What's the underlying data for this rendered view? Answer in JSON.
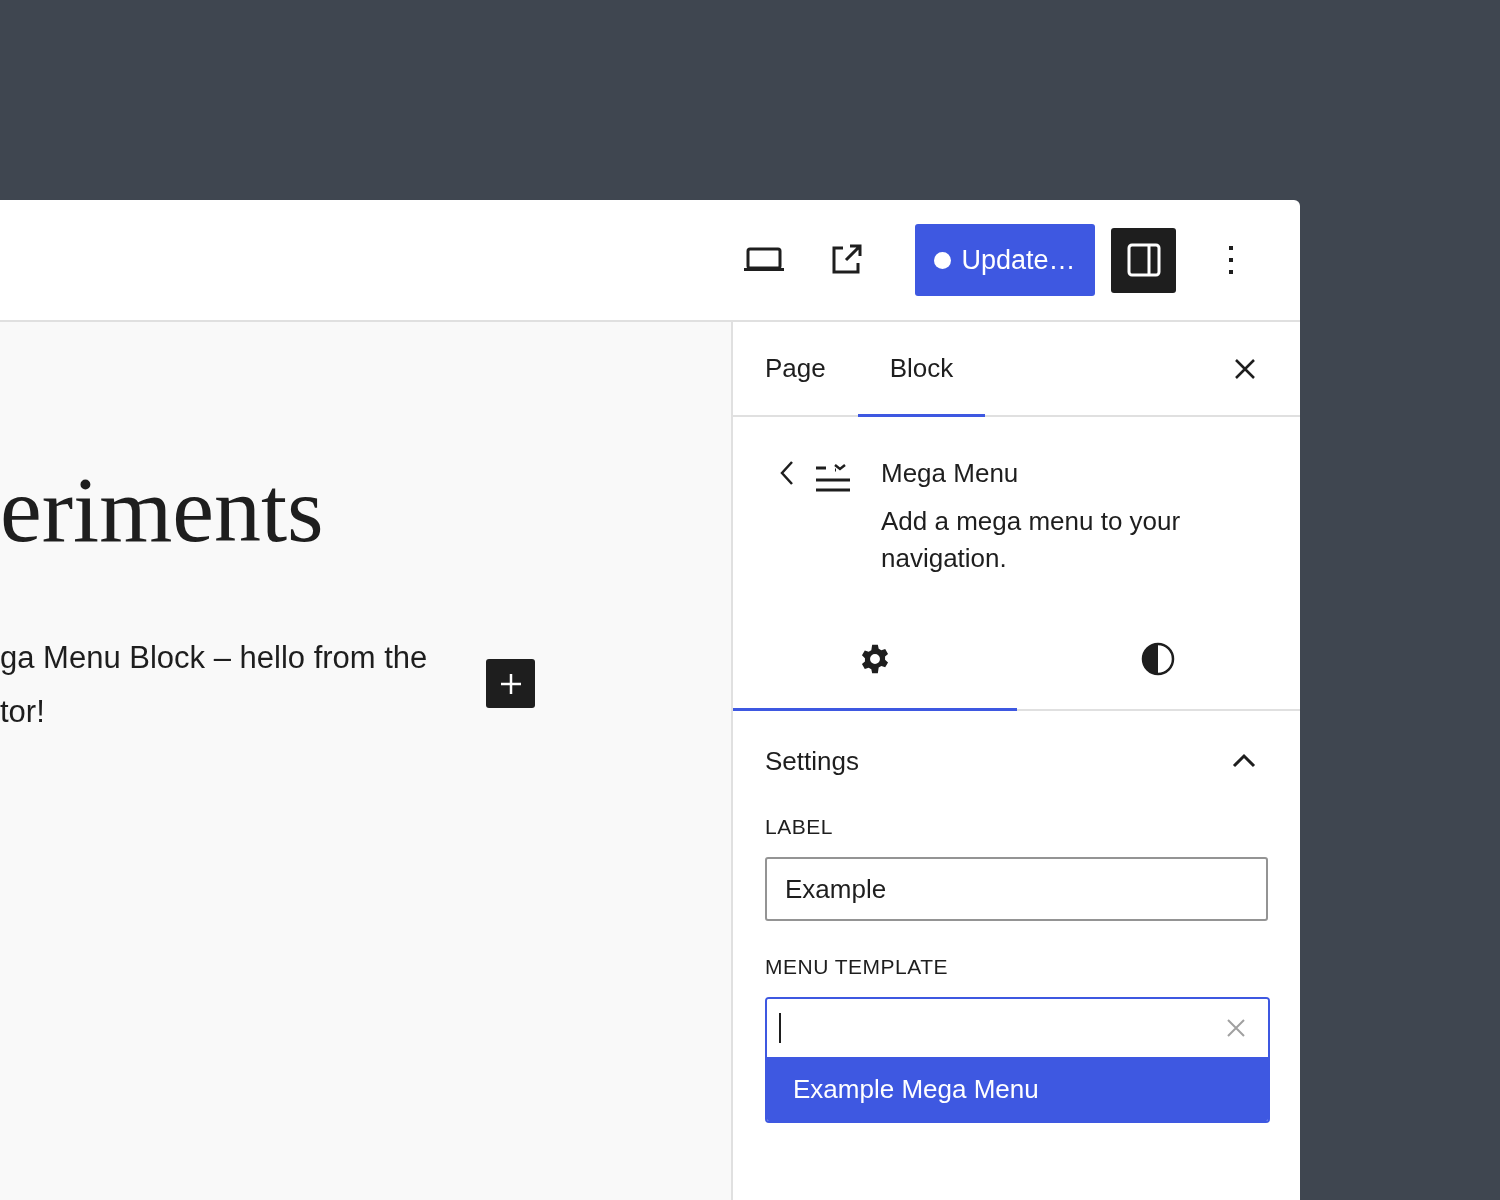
{
  "toolbar": {
    "update_button": "Update…",
    "unsaved": true,
    "sidebar_toggle_pressed": true
  },
  "canvas": {
    "heading": "eriments",
    "paragraph": "ga Menu Block – hello from the tor!"
  },
  "sidebar": {
    "tabs": [
      {
        "label": "Page",
        "selected": false
      },
      {
        "label": "Block",
        "selected": true
      }
    ],
    "block": {
      "title": "Mega Menu",
      "description": "Add a mega menu to your navigation."
    },
    "inspector_tabs": [
      {
        "kind": "settings",
        "selected": true
      },
      {
        "kind": "styles",
        "selected": false
      }
    ],
    "panel": {
      "title": "Settings",
      "expanded": true,
      "fields": [
        {
          "kind": "text",
          "label": "LABEL",
          "value": "Example"
        },
        {
          "kind": "combobox",
          "label": "MENU TEMPLATE",
          "focused": true,
          "options": [
            {
              "label": "Example Mega Menu",
              "selected": true
            }
          ]
        }
      ]
    }
  }
}
